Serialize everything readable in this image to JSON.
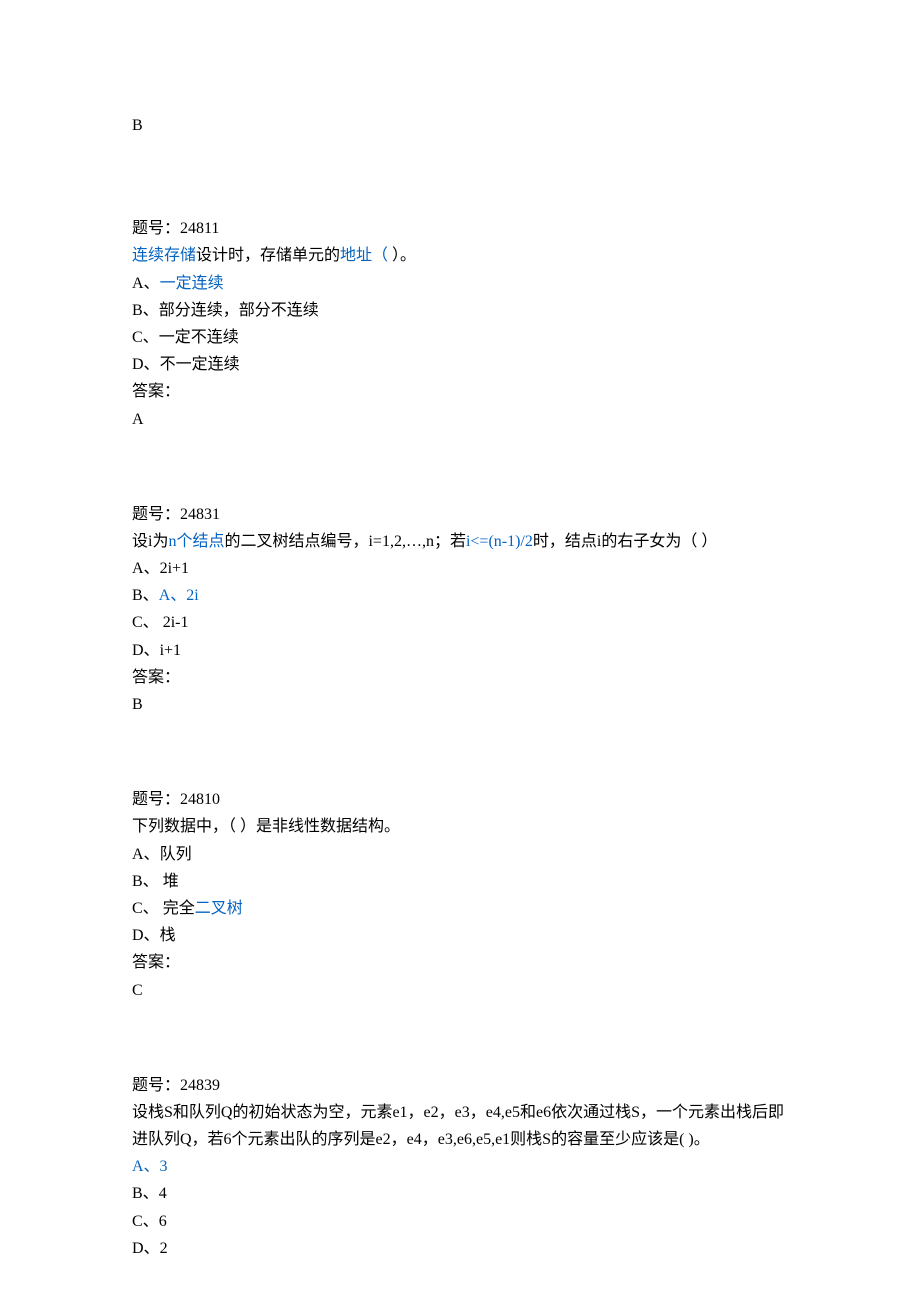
{
  "prev_answer": "B",
  "questions": [
    {
      "id": "24811",
      "header_label": "题号：",
      "stem_parts": [
        {
          "text": "连续存储",
          "link": true
        },
        {
          "text": "设计时，存储单元的",
          "link": false
        },
        {
          "text": "地址（",
          "link": true
        },
        {
          "text": "   ",
          "link": false
        },
        {
          "text": "）。",
          "link": false
        }
      ],
      "options": [
        {
          "label": "A、",
          "parts": [
            {
              "text": "一定连续",
              "link": true
            }
          ]
        },
        {
          "label": "B、",
          "parts": [
            {
              "text": "部分连续，部分不连续",
              "link": false
            }
          ]
        },
        {
          "label": "C、",
          "parts": [
            {
              "text": "一定不连续",
              "link": false
            }
          ]
        },
        {
          "label": "D、",
          "parts": [
            {
              "text": "不一定连续",
              "link": false
            }
          ]
        }
      ],
      "answer_label": "答案：",
      "answer": "A"
    },
    {
      "id": "24831",
      "header_label": "题号：",
      "stem_parts": [
        {
          "text": "设i为",
          "link": false
        },
        {
          "text": "n个结点",
          "link": true
        },
        {
          "text": "的二叉树结点编号，i=1,2,…,n；若",
          "link": false
        },
        {
          "text": "i<=(n-1)/2",
          "link": true
        },
        {
          "text": "时，结点i的右子女为（     ）",
          "link": false
        }
      ],
      "options": [
        {
          "label": "A、",
          "parts": [
            {
              "text": "2i+1",
              "link": false
            }
          ]
        },
        {
          "label": "B、",
          "parts": [
            {
              "text": "A、2i",
              "link": true
            }
          ]
        },
        {
          "label": "C、",
          "parts": [
            {
              "text": " 2i-1",
              "link": false
            }
          ]
        },
        {
          "label": "D、",
          "parts": [
            {
              "text": "i+1",
              "link": false
            }
          ]
        }
      ],
      "answer_label": "答案：",
      "answer": "B"
    },
    {
      "id": "24810",
      "header_label": "题号：",
      "stem_parts": [
        {
          "text": "下列数据中，（    ）是非线性数据结构。",
          "link": false
        }
      ],
      "options": [
        {
          "label": "A、",
          "parts": [
            {
              "text": "队列",
              "link": false
            }
          ]
        },
        {
          "label": "B、",
          "parts": [
            {
              "text": " 堆",
              "link": false
            }
          ]
        },
        {
          "label": "C、",
          "parts": [
            {
              "text": " 完全",
              "link": false
            },
            {
              "text": "二叉树",
              "link": true
            }
          ]
        },
        {
          "label": "D、",
          "parts": [
            {
              "text": "栈",
              "link": false
            }
          ]
        }
      ],
      "answer_label": "答案：",
      "answer": "C"
    },
    {
      "id": "24839",
      "header_label": "题号：",
      "stem_parts": [
        {
          "text": "设栈S和队列Q的初始状态为空，元素e1，e2，e3，e4,e5和e6依次通过栈S，一个元素出栈后即进队列Q，若6个元素出队的序列是e2，e4，e3,e6,e5,e1则栈S的容量至少应该是(    )。",
          "link": false
        }
      ],
      "options": [
        {
          "label": "",
          "parts": [
            {
              "text": "A、3",
              "link": true
            }
          ]
        },
        {
          "label": "B、",
          "parts": [
            {
              "text": "4",
              "link": false
            }
          ]
        },
        {
          "label": "C、",
          "parts": [
            {
              "text": "6",
              "link": false
            }
          ]
        },
        {
          "label": "D、",
          "parts": [
            {
              "text": "2",
              "link": false
            }
          ]
        }
      ],
      "answer_label": "",
      "answer": ""
    }
  ]
}
